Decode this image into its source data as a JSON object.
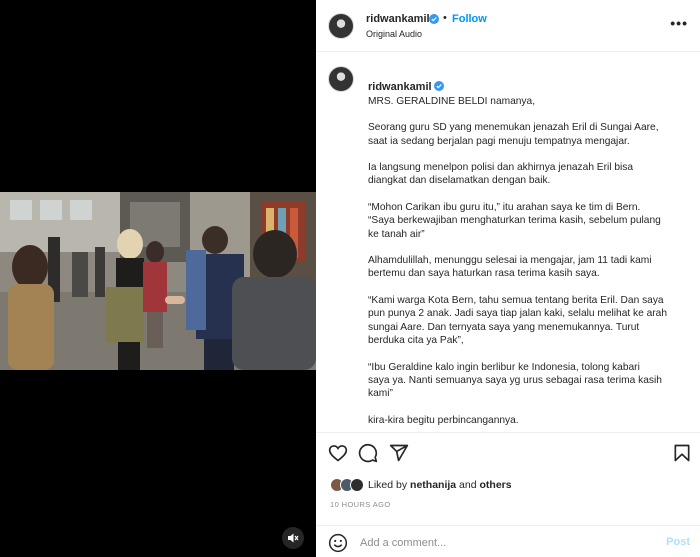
{
  "media": {
    "mute_icon": "speaker-muted-icon"
  },
  "header": {
    "username": "ridwankamil",
    "separator": "•",
    "follow_label": "Follow",
    "audio_label": "Original Audio",
    "more_label": "•••"
  },
  "caption": {
    "username": "ridwankamil",
    "first_line": "MRS. GERALDINE BELDI namanya,",
    "paragraphs": [
      "Seorang guru SD yang menemukan jenazah Eril di Sungai Aare,\nsaat ia sedang berjalan pagi menuju tempatnya mengajar.",
      "Ia langsung menelpon polisi dan akhirnya jenazah Eril bisa\ndiangkat dan diselamatkan dengan baik.",
      "“Mohon Carikan ibu guru itu,” itu arahan saya ke tim di Bern.\n“Saya berkewajiban menghaturkan terima kasih, sebelum pulang\nke tanah air”",
      "Alhamdulillah, menunggu selesai ia mengajar, jam 11 tadi kami\nbertemu dan saya haturkan rasa terima kasih saya.",
      "“Kami warga Kota Bern, tahu semua tentang berita Eril. Dan saya\npun punya 2 anak. Jadi saya tiap jalan kaki, selalu melihat ke arah\nsungai Aare. Dan ternyata saya yang menemukannya. Turut\nberduka cita ya Pak”,",
      "“Ibu Geraldine kalo ingin berlibur ke Indonesia, tolong kabari\nsaya ya. Nanti semuanya saya yg urus sebagai rasa terima kasih\nkami”",
      "kira-kira begitu perbincangannya."
    ]
  },
  "actions": {
    "like_icon": "heart-icon",
    "comment_icon": "comment-icon",
    "share_icon": "share-icon",
    "save_icon": "bookmark-icon",
    "liked_by_prefix": "Liked by",
    "liked_by_user": "nethanija",
    "liked_by_and": "and",
    "liked_by_others": "others",
    "timestamp": "10 HOURS AGO"
  },
  "comment": {
    "placeholder": "Add a comment...",
    "post_label": "Post"
  },
  "colors": {
    "accent": "#0095f6",
    "post_disabled": "#b2dffc",
    "verified": "#3897f0"
  }
}
